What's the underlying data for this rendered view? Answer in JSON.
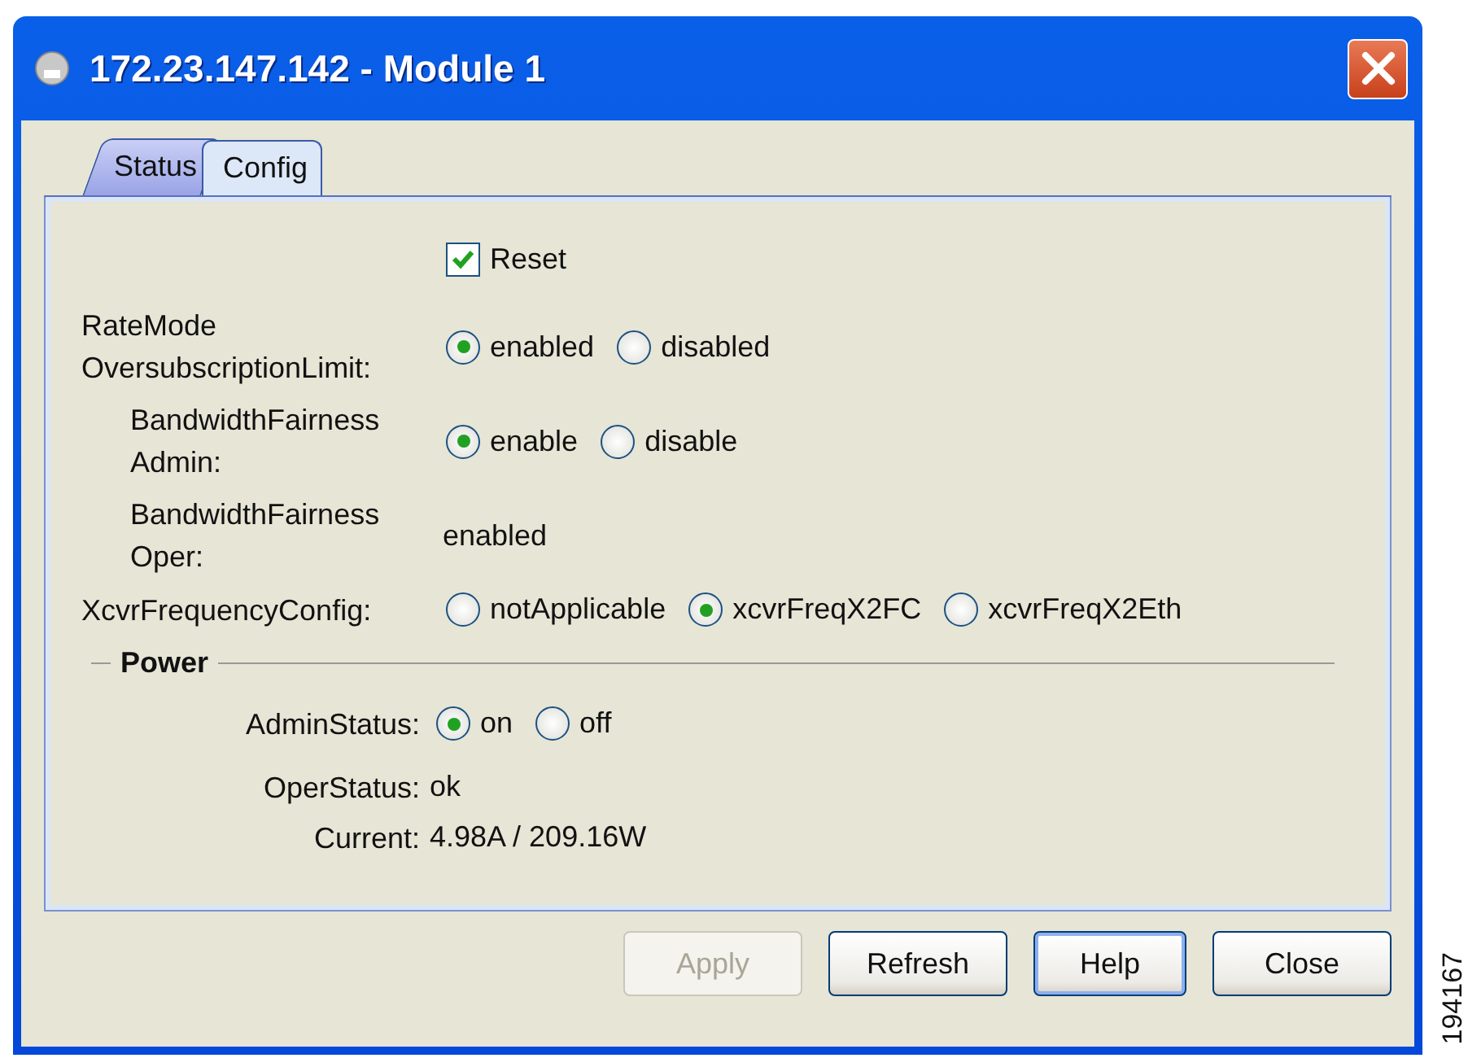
{
  "window": {
    "title": "172.23.147.142 - Module 1"
  },
  "tabs": [
    {
      "label": "Status",
      "selected": false
    },
    {
      "label": "Config",
      "selected": true
    }
  ],
  "fields": [
    {
      "kind": "checkbox",
      "text": "Reset",
      "checked": true
    },
    {
      "kind": "radio",
      "label": "RateMode OversubscriptionLimit:",
      "options": [
        {
          "text": "enabled",
          "selected": true
        },
        {
          "text": "disabled",
          "selected": false
        }
      ]
    },
    {
      "kind": "radio",
      "label": "BandwidthFairness Admin:",
      "options": [
        {
          "text": "enable",
          "selected": true
        },
        {
          "text": "disable",
          "selected": false
        }
      ]
    },
    {
      "kind": "text",
      "label": "BandwidthFairness Oper:",
      "value": "enabled"
    },
    {
      "kind": "radio",
      "label": "XcvrFrequencyConfig:",
      "options": [
        {
          "text": "notApplicable",
          "selected": false
        },
        {
          "text": "xcvrFreqX2FC",
          "selected": true
        },
        {
          "text": "xcvrFreqX2Eth",
          "selected": false
        }
      ]
    }
  ],
  "power": {
    "title": "Power",
    "fields": [
      {
        "kind": "radio",
        "label": "AdminStatus:",
        "options": [
          {
            "text": "on",
            "selected": true
          },
          {
            "text": "off",
            "selected": false
          }
        ]
      },
      {
        "kind": "text",
        "label": "OperStatus:",
        "value": "ok"
      },
      {
        "kind": "text",
        "label": "Current:",
        "value": "4.98A / 209.16W"
      }
    ]
  },
  "buttons": [
    {
      "label": "Apply",
      "disabled": true,
      "focused": false
    },
    {
      "label": "Refresh",
      "disabled": false,
      "focused": false
    },
    {
      "label": "Help",
      "disabled": false,
      "focused": true
    },
    {
      "label": "Close",
      "disabled": false,
      "focused": false
    }
  ],
  "figure_id": "194167"
}
